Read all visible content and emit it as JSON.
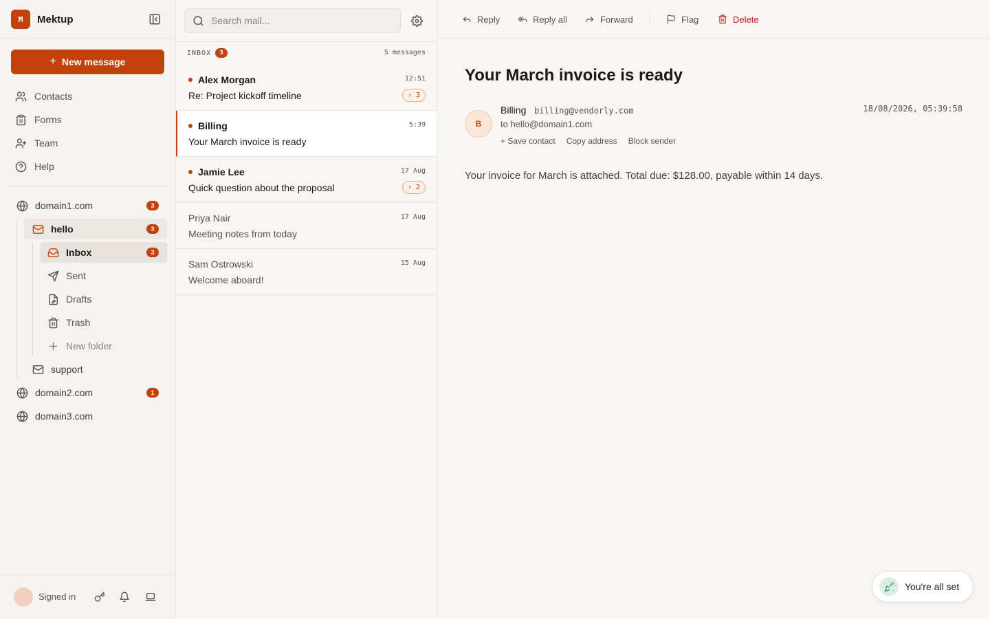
{
  "app": {
    "name": "Mektup",
    "logo_letter": "M",
    "accent_color": "#c2410c"
  },
  "sidebar": {
    "new_message_label": "New message",
    "nav": [
      {
        "label": "Contacts",
        "icon": "users-icon"
      },
      {
        "label": "Forms",
        "icon": "clipboard-icon"
      },
      {
        "label": "Team",
        "icon": "user-plus-icon"
      },
      {
        "label": "Help",
        "icon": "help-circle-icon"
      }
    ],
    "accounts": [
      {
        "label": "domain1.com",
        "badge": "3"
      },
      {
        "label": "domain2.com",
        "badge": "1"
      },
      {
        "label": "domain3.com"
      }
    ],
    "mailboxes": [
      {
        "label": "hello",
        "badge": "3"
      },
      {
        "label": "support"
      }
    ],
    "folders": [
      {
        "label": "Inbox",
        "badge": "3"
      },
      {
        "label": "Sent"
      },
      {
        "label": "Drafts"
      },
      {
        "label": "Trash"
      },
      {
        "label": "New folder"
      }
    ],
    "footer": {
      "status": "Signed in"
    }
  },
  "list": {
    "search_placeholder": "Search mail...",
    "header": {
      "label": "INBOX",
      "badge": "3",
      "count": "5 messages"
    },
    "messages": [
      {
        "sender": "Alex Morgan",
        "subject": "Re: Project kickoff timeline",
        "time": "12:51",
        "unread": true,
        "thread": "› 3"
      },
      {
        "sender": "Billing",
        "subject": "Your March invoice is ready",
        "time": "5:39",
        "unread": true,
        "selected": true
      },
      {
        "sender": "Jamie Lee",
        "subject": "Quick question about the proposal",
        "time": "17 Aug",
        "unread": true,
        "thread": "› 2"
      },
      {
        "sender": "Priya Nair",
        "subject": "Meeting notes from today",
        "time": "17 Aug",
        "unread": false
      },
      {
        "sender": "Sam Ostrowski",
        "subject": "Welcome aboard!",
        "time": "15 Aug",
        "unread": false
      }
    ]
  },
  "reader": {
    "toolbar": {
      "reply": "Reply",
      "reply_all": "Reply all",
      "forward": "Forward",
      "flag": "Flag",
      "delete": "Delete"
    },
    "subject": "Your March invoice is ready",
    "avatar_letter": "B",
    "from_name": "Billing",
    "from_email": "billing@vendorly.com",
    "to": "to hello@domain1.com",
    "date": "18/08/2026, 05:39:58",
    "actions": {
      "save": "+ Save contact",
      "copy": "Copy address",
      "block": "Block sender"
    },
    "body": "Your invoice for March is attached. Total due: $128.00, payable within 14 days."
  },
  "toast": {
    "text": "You're all set"
  }
}
